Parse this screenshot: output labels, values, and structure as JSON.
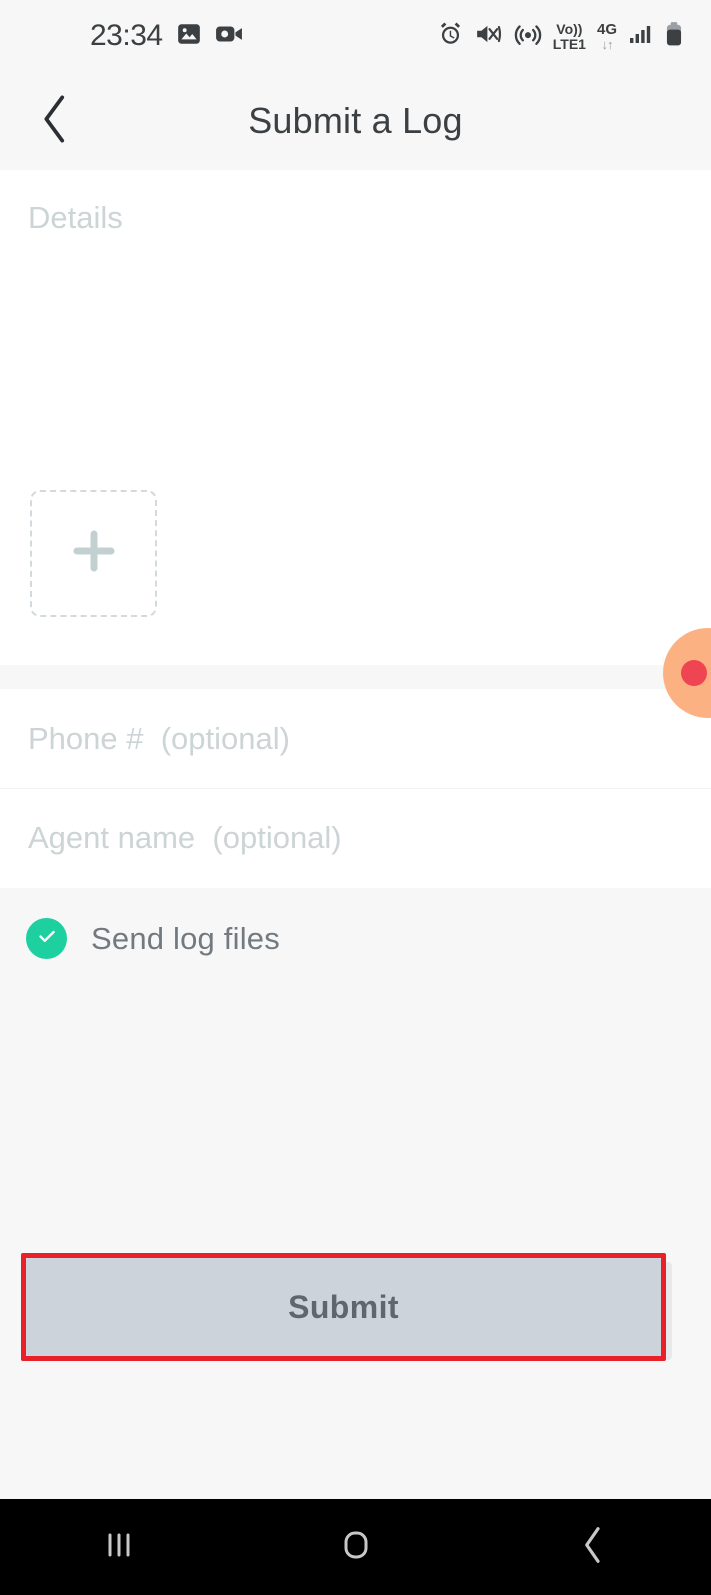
{
  "status_bar": {
    "time": "23:34",
    "left_icons": [
      "image-icon",
      "video-camera-icon"
    ],
    "right_icons": [
      "alarm-icon",
      "mute-vibrate-icon",
      "hotspot-icon"
    ],
    "volte_line1": "Vo))",
    "volte_line2": "LTE1",
    "network_type": "4G",
    "data_arrows": "↓↑",
    "signal_icon": "signal-bars-icon",
    "battery_icon": "battery-icon"
  },
  "header": {
    "back_icon": "chevron-left-icon",
    "title": "Submit a Log"
  },
  "form": {
    "details_placeholder": "Details",
    "details_value": "",
    "attachment_icon": "plus-icon",
    "phone_placeholder": "Phone #  (optional)",
    "phone_value": "",
    "agent_placeholder": "Agent name  (optional)",
    "agent_value": "",
    "send_logs_label": "Send log files",
    "send_logs_checked": true,
    "check_icon": "check-icon",
    "submit_label": "Submit"
  },
  "colors": {
    "accent_green": "#1ecfa0",
    "annotation_red": "#e8202a",
    "submit_gray": "#ccd3da",
    "placeholder_gray": "#ccd4d6",
    "bubble_peach": "#fcb183",
    "bubble_dot": "#ef4452"
  },
  "nav_bar": {
    "recents_icon": "recents-icon",
    "home_icon": "home-icon",
    "back_icon": "back-icon"
  }
}
